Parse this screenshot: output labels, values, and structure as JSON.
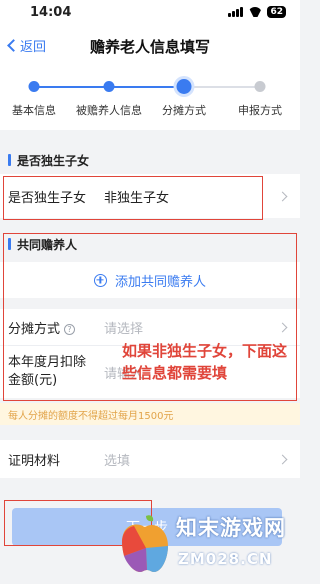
{
  "status_bar": {
    "time": "14:04",
    "battery": "62"
  },
  "nav": {
    "back_label": "返回",
    "title": "赡养老人信息填写"
  },
  "steps": [
    {
      "label": "基本信息",
      "state": "done"
    },
    {
      "label": "被赡养人信息",
      "state": "done"
    },
    {
      "label": "分摊方式",
      "state": "current"
    },
    {
      "label": "申报方式",
      "state": "todo"
    }
  ],
  "only_child": {
    "section_title": "是否独生子女",
    "field_label": "是否独生子女",
    "field_value": "非独生子女"
  },
  "co_supporter": {
    "section_title": "共同赡养人",
    "add_label": "添加共同赡养人"
  },
  "allocation": {
    "method_label": "分摊方式",
    "method_help": "?",
    "method_placeholder": "请选择",
    "monthly_label_1": "本年度月扣除",
    "monthly_label_2": "金额(元)",
    "monthly_placeholder": "请输入"
  },
  "annotation_text": "如果非独生子女，下面这些信息都需要填",
  "notice_text": "每人分摊的额度不得超过每月1500元",
  "proof": {
    "label": "证明材料",
    "placeholder": "选填"
  },
  "submit": {
    "label": "下一步"
  },
  "watermark": {
    "title": "知末游戏网",
    "url": "ZM028.CN"
  },
  "colors": {
    "accent": "#3a7bf0",
    "annotation_red": "#e0453a",
    "notice_bg": "#fff6e0",
    "notice_text": "#e2a44a"
  }
}
